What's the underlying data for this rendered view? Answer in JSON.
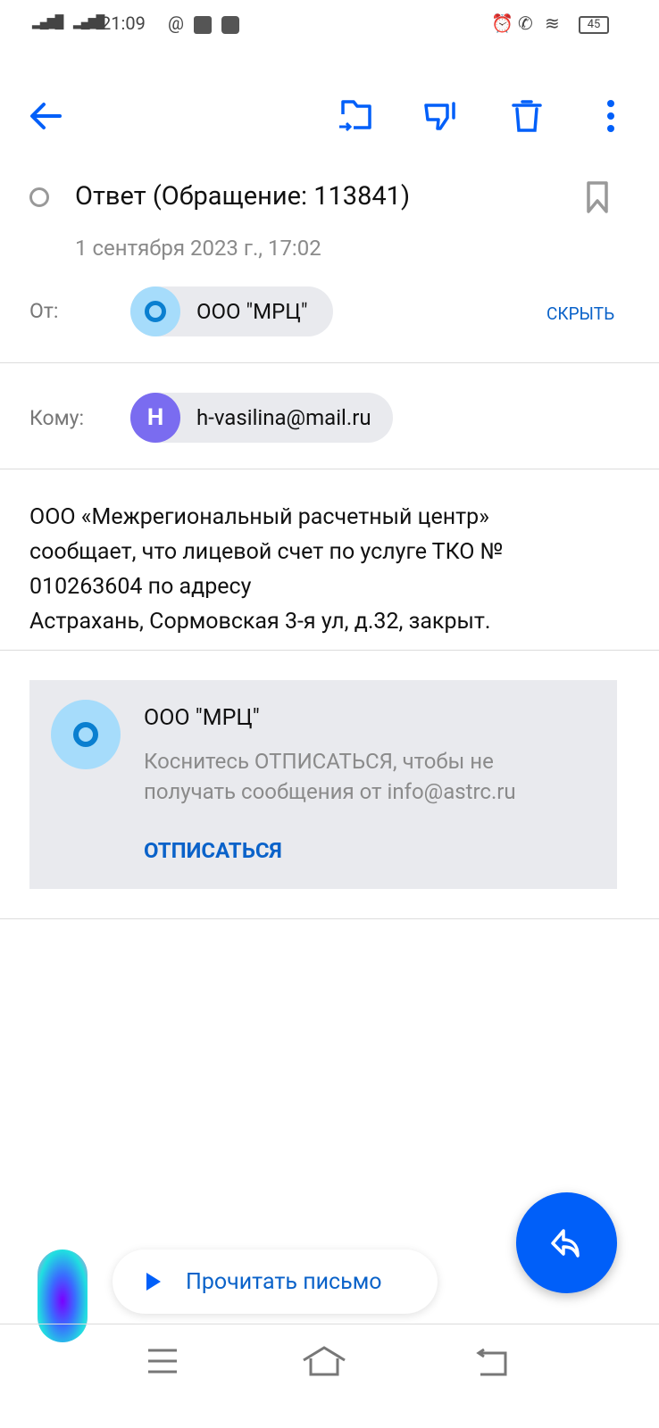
{
  "status_bar": {
    "time": "21:09",
    "battery": "45"
  },
  "toolbar": {
    "back": "back-arrow-icon",
    "move": "move-to-folder-icon",
    "spam": "thumbs-down-icon",
    "delete": "trash-icon",
    "more": "more-vert-icon"
  },
  "email": {
    "subject": "Ответ (Обращение: 113841)",
    "date": "1 сентября 2023 г., 17:02",
    "from_label": "От:",
    "from_name": "ООО \"МРЦ\"",
    "hide_label": "СКРЫТЬ",
    "to_label": "Кому:",
    "to_initial": "H",
    "to_email": "h-vasilina@mail.ru",
    "body": [
      "ООО «Межрегиональный расчетный центр»",
      "сообщает, что лицевой счет по услуге ТКО №",
      "010263604 по адресу",
      "Астрахань, Сормовская 3-я ул, д.32, закрыт."
    ]
  },
  "unsubscribe": {
    "sender": "ООО \"МРЦ\"",
    "text": "Коснитесь ОТПИСАТЬСЯ, чтобы не получать сообщения от info@astrc.ru",
    "button": "ОТПИСАТЬСЯ"
  },
  "assistant": {
    "read_label": "Прочитать письмо"
  },
  "colors": {
    "accent": "#005ff9",
    "chip": "#e9eaee",
    "avatar_org": "#a6dcfb",
    "avatar_user": "#7a6cf0"
  }
}
